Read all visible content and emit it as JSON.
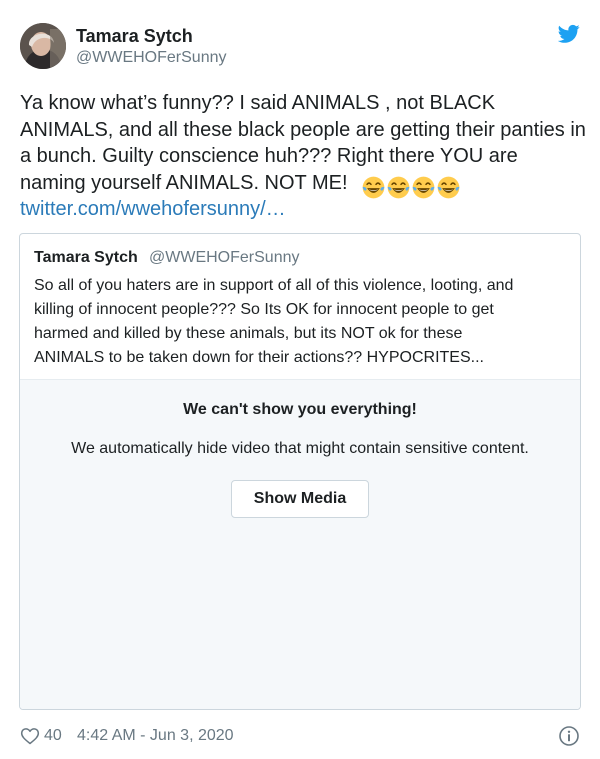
{
  "tweet": {
    "author": {
      "name": "Tamara Sytch",
      "handle": "@WWEHOFerSunny"
    },
    "text_lines": [
      "Ya know what’s funny??  I said ANIMALS , not BLACK",
      "ANIMALS, and all these black people are getting their panties in",
      "a bunch. Guilty conscience huh???  Right there YOU are",
      "naming yourself ANIMALS. NOT ME!"
    ],
    "emoji": "face-with-tears-of-joy",
    "emoji_count": 4,
    "link": "twitter.com/wwehofersunny/…",
    "brand_color": "#1da1f2",
    "link_color": "#2b7bb9"
  },
  "quoted": {
    "name": "Tamara Sytch",
    "handle": "@WWEHOFerSunny",
    "text_lines": [
      "So all of you haters are in support of all of this violence, looting, and",
      "killing of innocent people???  So Its OK for innocent people to get",
      "harmed and killed by these animals, but its NOT ok for these",
      "ANIMALS to be taken down for their actions??  HYPOCRITES..."
    ]
  },
  "sensitive": {
    "title": "We can't show you everything!",
    "description": "We automatically hide video that might contain sensitive content.",
    "button_label": "Show Media"
  },
  "footer": {
    "likes": "40",
    "timestamp": "4:42 AM - Jun 3, 2020"
  },
  "icons": {
    "logo": "twitter-bird-icon",
    "like": "heart-icon",
    "info": "info-icon"
  }
}
